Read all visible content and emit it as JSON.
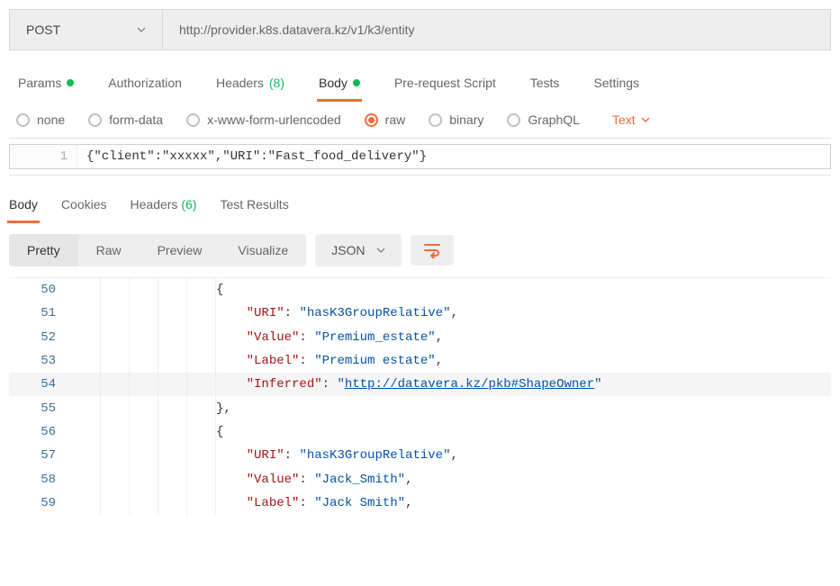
{
  "request": {
    "method": "POST",
    "url": "http://provider.k8s.datavera.kz/v1/k3/entity",
    "body_raw": "{\"client\":\"xxxxx\",\"URI\":\"Fast_food_delivery\"}"
  },
  "tabs": {
    "params": "Params",
    "auth": "Authorization",
    "headers": "Headers",
    "headers_count": "(8)",
    "body": "Body",
    "prereq": "Pre-request Script",
    "tests": "Tests",
    "settings": "Settings"
  },
  "bodyTypes": {
    "none": "none",
    "formdata": "form-data",
    "urlencoded": "x-www-form-urlencoded",
    "raw": "raw",
    "binary": "binary",
    "graphql": "GraphQL",
    "textLabel": "Text"
  },
  "editor": {
    "line": "1"
  },
  "response": {
    "tabs": {
      "body": "Body",
      "cookies": "Cookies",
      "headers": "Headers",
      "headers_count": "(6)",
      "tests": "Test Results"
    },
    "viewModes": {
      "pretty": "Pretty",
      "raw": "Raw",
      "preview": "Preview",
      "visualize": "Visualize"
    },
    "format": "JSON",
    "lines": {
      "50": {
        "indent": 5,
        "content": [
          {
            "t": "punc",
            "v": "{"
          }
        ]
      },
      "51": {
        "indent": 6,
        "content": [
          {
            "t": "key",
            "v": "\"URI\""
          },
          {
            "t": "punc",
            "v": ": "
          },
          {
            "t": "str",
            "v": "\"hasK3GroupRelative\""
          },
          {
            "t": "punc",
            "v": ","
          }
        ]
      },
      "52": {
        "indent": 6,
        "content": [
          {
            "t": "key",
            "v": "\"Value\""
          },
          {
            "t": "punc",
            "v": ": "
          },
          {
            "t": "str",
            "v": "\"Premium_estate\""
          },
          {
            "t": "punc",
            "v": ","
          }
        ]
      },
      "53": {
        "indent": 6,
        "content": [
          {
            "t": "key",
            "v": "\"Label\""
          },
          {
            "t": "punc",
            "v": ": "
          },
          {
            "t": "str",
            "v": "\"Premium estate\""
          },
          {
            "t": "punc",
            "v": ","
          }
        ]
      },
      "54": {
        "indent": 6,
        "content": [
          {
            "t": "key",
            "v": "\"Inferred\""
          },
          {
            "t": "punc",
            "v": ": "
          },
          {
            "t": "str",
            "v": "\""
          },
          {
            "t": "link",
            "v": "http://datavera.kz/pkb#ShapeOwner"
          },
          {
            "t": "str",
            "v": "\""
          }
        ]
      },
      "55": {
        "indent": 5,
        "content": [
          {
            "t": "punc",
            "v": "},"
          }
        ]
      },
      "56": {
        "indent": 5,
        "content": [
          {
            "t": "punc",
            "v": "{"
          }
        ]
      },
      "57": {
        "indent": 6,
        "content": [
          {
            "t": "key",
            "v": "\"URI\""
          },
          {
            "t": "punc",
            "v": ": "
          },
          {
            "t": "str",
            "v": "\"hasK3GroupRelative\""
          },
          {
            "t": "punc",
            "v": ","
          }
        ]
      },
      "58": {
        "indent": 6,
        "content": [
          {
            "t": "key",
            "v": "\"Value\""
          },
          {
            "t": "punc",
            "v": ": "
          },
          {
            "t": "str",
            "v": "\"Jack_Smith\""
          },
          {
            "t": "punc",
            "v": ","
          }
        ]
      },
      "59": {
        "indent": 6,
        "content": [
          {
            "t": "key",
            "v": "\"Label\""
          },
          {
            "t": "punc",
            "v": ": "
          },
          {
            "t": "str",
            "v": "\"Jack Smith\""
          },
          {
            "t": "punc",
            "v": ","
          }
        ]
      }
    },
    "lineOrder": [
      "50",
      "51",
      "52",
      "53",
      "54",
      "55",
      "56",
      "57",
      "58",
      "59"
    ]
  }
}
